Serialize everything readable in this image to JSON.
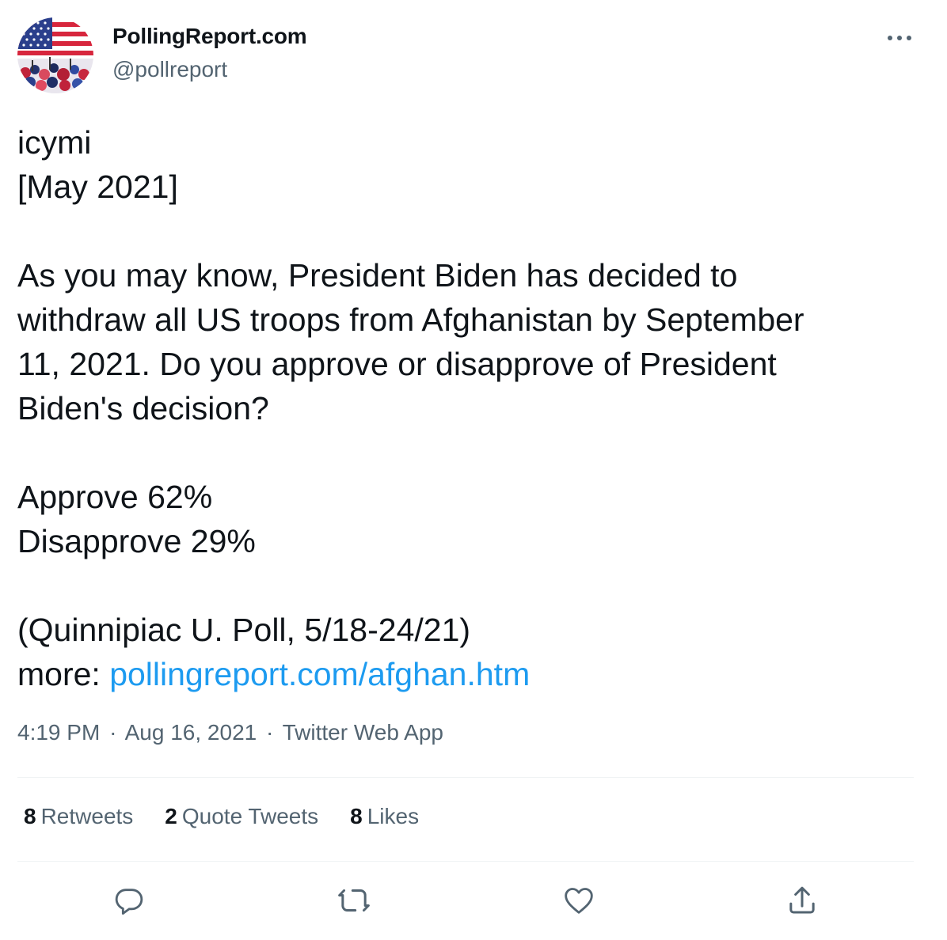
{
  "author": {
    "display_name": "PollingReport.com",
    "handle": "@pollreport"
  },
  "tweet": {
    "lines": {
      "l1": "icymi",
      "l2": "[May 2021]",
      "l3": "As you may know, President Biden has decided to",
      "l4": "withdraw all US troops from Afghanistan by September",
      "l5": "11, 2021. Do you approve or disapprove of President",
      "l6": "Biden's decision?",
      "l7": "Approve 62%",
      "l8": "Disapprove 29%",
      "l9": "(Quinnipiac U. Poll, 5/18-24/21)",
      "l10_prefix": "more: ",
      "link_text": "pollingreport.com/afghan.htm"
    },
    "time": "4:19 PM",
    "date": "Aug 16, 2021",
    "source": "Twitter Web App",
    "separator": "·"
  },
  "stats": {
    "retweets_count": "8",
    "retweets_label": "Retweets",
    "quote_count": "2",
    "quote_label": "Quote Tweets",
    "likes_count": "8",
    "likes_label": "Likes"
  },
  "icons": {
    "more": "more-horizontal-icon",
    "reply": "reply-icon",
    "retweet": "retweet-icon",
    "like": "heart-icon",
    "share": "share-icon"
  },
  "colors": {
    "text": "#0f1419",
    "secondary": "#536471",
    "link": "#1d9bf0",
    "divider": "#eff3f4"
  }
}
